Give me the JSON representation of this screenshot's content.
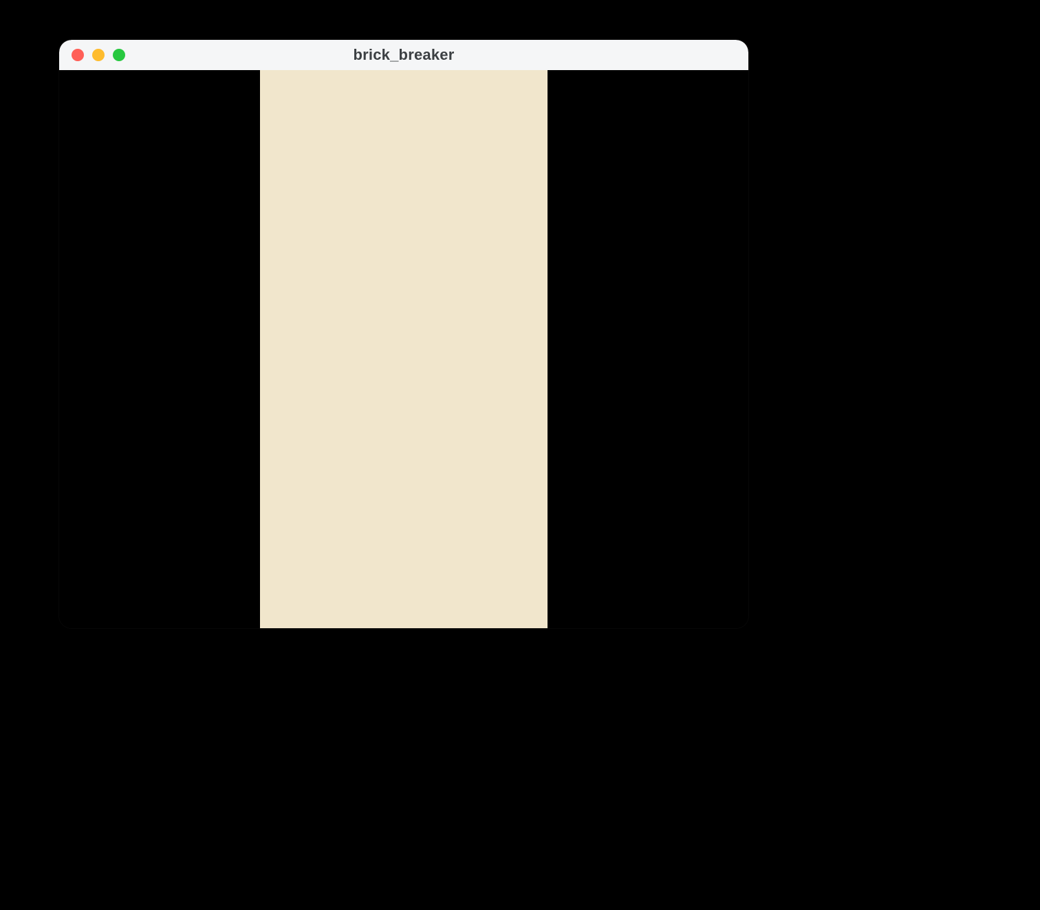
{
  "window": {
    "title": "brick_breaker"
  },
  "colors": {
    "desktop_background": "#000000",
    "titlebar_background": "#f5f6f7",
    "titlebar_text": "#3c4043",
    "traffic_red": "#ff5f57",
    "traffic_yellow": "#febc2e",
    "traffic_green": "#28c840",
    "window_content_background": "#000000",
    "game_canvas_background": "#f1e6cc"
  }
}
